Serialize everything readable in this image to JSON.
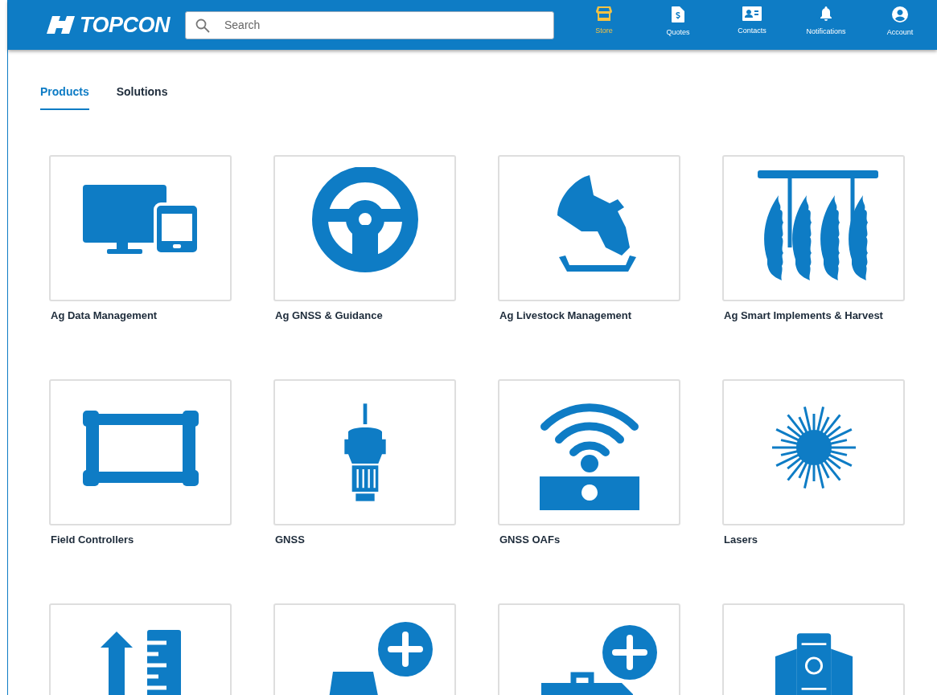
{
  "header": {
    "logo": "TOPCON",
    "search": {
      "placeholder": "Search"
    },
    "nav": [
      {
        "label": "Store",
        "kind": "store",
        "selected": true
      },
      {
        "label": "Quotes",
        "kind": "quote",
        "selected": false
      },
      {
        "label": "Contacts",
        "kind": "contacts",
        "selected": false
      },
      {
        "label": "Notifications",
        "kind": "bell",
        "selected": false
      },
      {
        "label": "Account",
        "kind": "account",
        "selected": false
      }
    ]
  },
  "tabs": [
    {
      "label": "Products",
      "selected": true
    },
    {
      "label": "Solutions",
      "selected": false
    }
  ],
  "products": [
    {
      "label": "Ag Data Management",
      "kind": "devices"
    },
    {
      "label": "Ag GNSS & Guidance",
      "kind": "wheel"
    },
    {
      "label": "Ag Livestock Management",
      "kind": "livestock"
    },
    {
      "label": "Ag Smart Implements & Harvest",
      "kind": "implement"
    },
    {
      "label": "Field Controllers",
      "kind": "controller"
    },
    {
      "label": "GNSS",
      "kind": "receiver"
    },
    {
      "label": "GNSS OAFs",
      "kind": "wireless"
    },
    {
      "label": "Lasers",
      "kind": "laser"
    },
    {
      "kind": "ruler"
    },
    {
      "kind": "tractor"
    },
    {
      "kind": "toolbox"
    },
    {
      "kind": "station"
    }
  ]
}
